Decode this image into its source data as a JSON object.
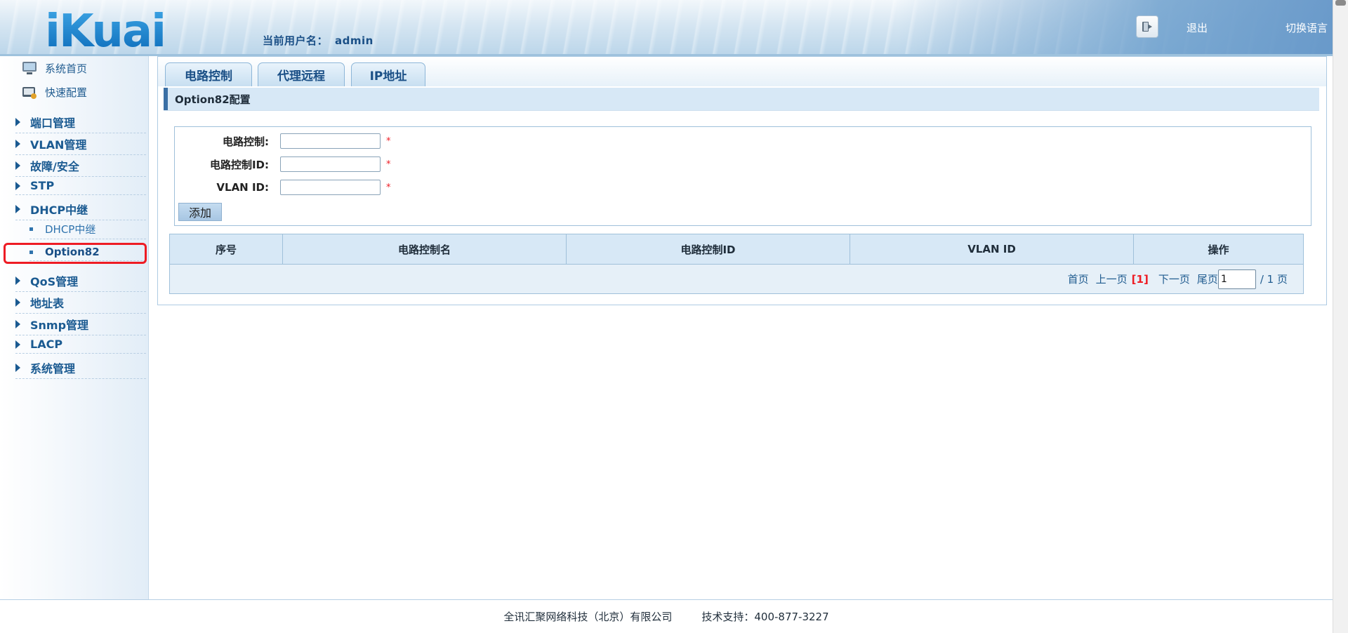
{
  "header": {
    "logo_text": "iKuai",
    "user_label": "当前用户名：",
    "user_name": "admin",
    "exit_label": "退出",
    "lang_label": "切换语言"
  },
  "sidebar": {
    "top_items": [
      {
        "label": "系统首页",
        "icon": "monitor-icon"
      },
      {
        "label": "快速配置",
        "icon": "quick-config-icon"
      }
    ],
    "groups": [
      {
        "label": "端口管理"
      },
      {
        "label": "VLAN管理"
      },
      {
        "label": "故障/安全"
      },
      {
        "label": "STP"
      },
      {
        "label": "DHCP中继"
      },
      {
        "label": "QoS管理"
      },
      {
        "label": "地址表"
      },
      {
        "label": "Snmp管理"
      },
      {
        "label": "LACP"
      },
      {
        "label": "系统管理"
      }
    ],
    "sub_items": [
      {
        "label": "DHCP中继"
      },
      {
        "label": "Option82",
        "active": true
      }
    ]
  },
  "tabs": [
    {
      "label": "电路控制"
    },
    {
      "label": "代理远程"
    },
    {
      "label": "IP地址"
    }
  ],
  "section_title": "Option82配置",
  "form": {
    "fields": [
      {
        "label": "电路控制:",
        "value": "",
        "required": "*"
      },
      {
        "label": "电路控制ID:",
        "value": "",
        "required": "*"
      },
      {
        "label": "VLAN ID:",
        "value": "",
        "required": "*"
      }
    ],
    "add_button": "添加"
  },
  "table": {
    "columns": [
      "序号",
      "电路控制名",
      "电路控制ID",
      "VLAN ID",
      "操作"
    ],
    "rows": []
  },
  "pager": {
    "first": "首页",
    "prev": "上一页",
    "current": "[1]",
    "next": "下一页",
    "last": "尾页",
    "page_input": "1",
    "total": "/ 1 页"
  },
  "footer": {
    "company": "全讯汇聚网络科技（北京）有限公司",
    "support": "技术支持：400-877-3227"
  },
  "colors": {
    "accent": "#1a4f86",
    "highlight": "#ee1c24",
    "header_bg": "#bcd6ea"
  }
}
